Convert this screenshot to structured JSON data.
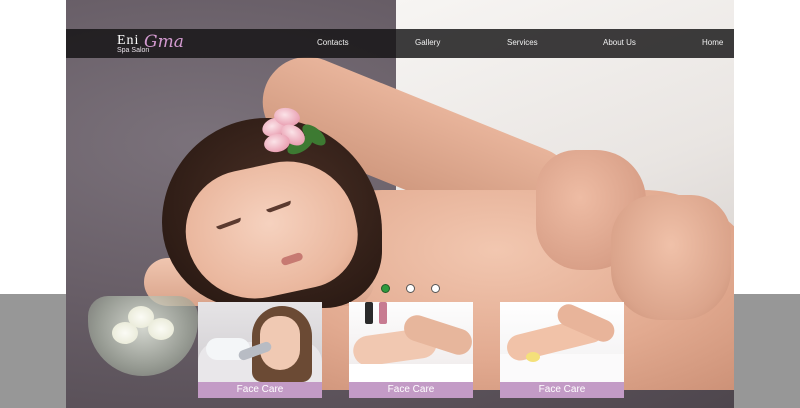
{
  "brand": {
    "name_part1": "Eni",
    "name_part2": "Gma",
    "tagline": "Spa Salon"
  },
  "nav": {
    "items": [
      {
        "label": "Contacts"
      },
      {
        "label": "Gallery"
      },
      {
        "label": "Services"
      },
      {
        "label": "About Us"
      },
      {
        "label": "Home"
      }
    ]
  },
  "slider": {
    "dots": [
      {
        "state": "active",
        "color": "#2e9a3e"
      },
      {
        "state": "inactive",
        "color": "#ffffff"
      },
      {
        "state": "inactive",
        "color": "#ffffff"
      }
    ]
  },
  "cards": [
    {
      "title": "Face Care",
      "image": "facial-treatment-photo"
    },
    {
      "title": "Face Care",
      "image": "manicure-photo"
    },
    {
      "title": "Face Care",
      "image": "pedicure-photo"
    }
  ],
  "colors": {
    "nav_bg": "#141214",
    "brand_accent": "#d39ad0",
    "card_caption_bg": "#c39bc6",
    "band_bg": "#808080"
  }
}
